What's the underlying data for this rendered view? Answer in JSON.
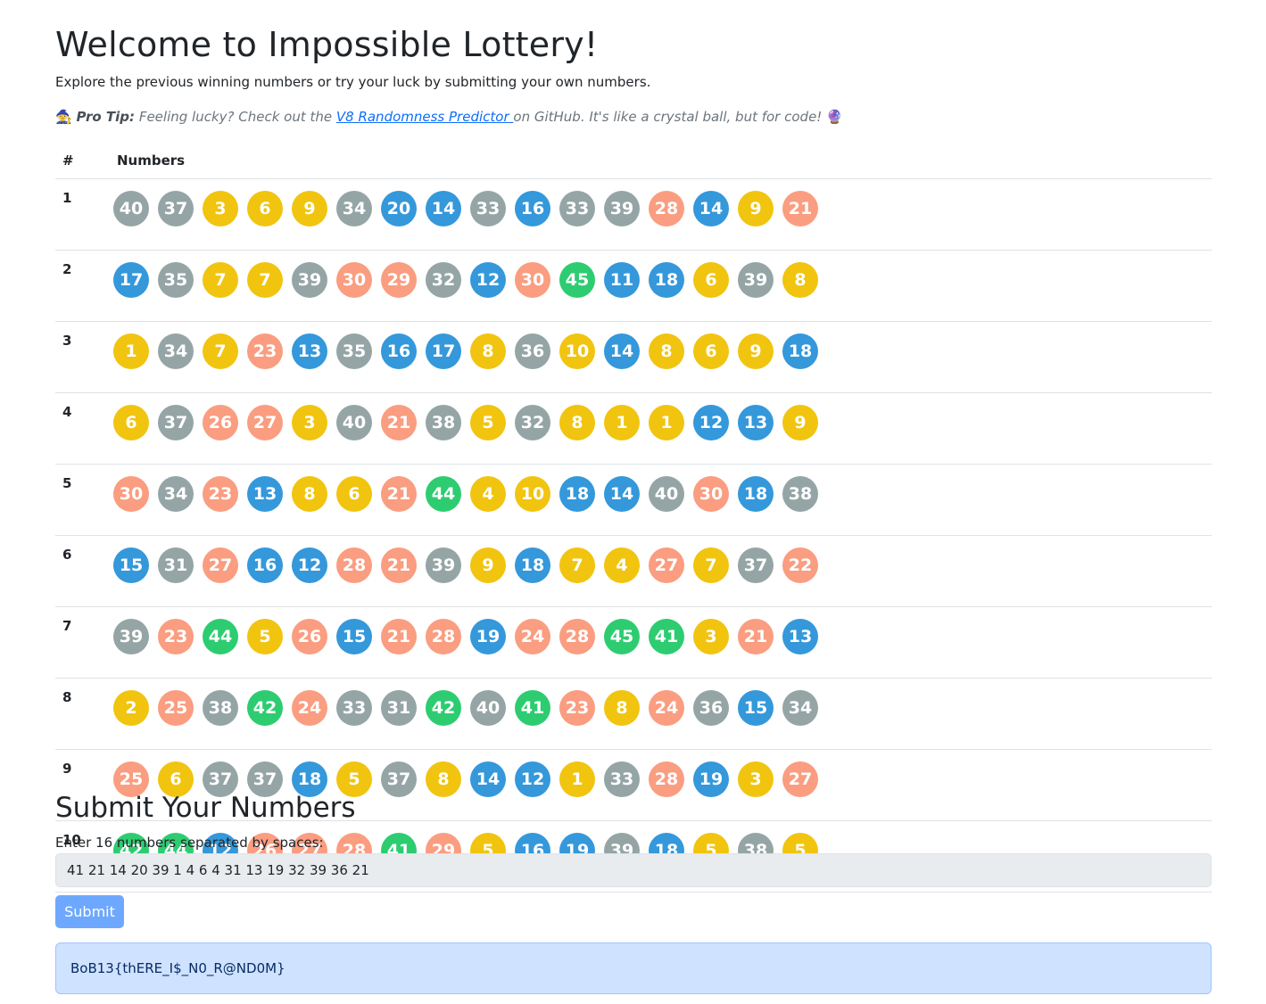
{
  "header": {
    "title": "Welcome to Impossible Lottery!",
    "lead": "Explore the previous winning numbers or try your luck by submitting your own numbers."
  },
  "tip": {
    "icon_start": "🧙",
    "label": "Pro Tip:",
    "before_link": " Feeling lucky? Check out the ",
    "link_text": "V8 Randomness Predictor ",
    "after_link": "on GitHub. It's like a crystal ball, but for code! ",
    "icon_end": "🔮"
  },
  "table": {
    "headers": [
      "#",
      "Numbers"
    ],
    "rows": [
      {
        "index": "1",
        "numbers": [
          40,
          37,
          3,
          6,
          9,
          34,
          20,
          14,
          33,
          16,
          33,
          39,
          28,
          14,
          9,
          21
        ]
      },
      {
        "index": "2",
        "numbers": [
          17,
          35,
          7,
          7,
          39,
          30,
          29,
          32,
          12,
          30,
          45,
          11,
          18,
          6,
          39,
          8
        ]
      },
      {
        "index": "3",
        "numbers": [
          1,
          34,
          7,
          23,
          13,
          35,
          16,
          17,
          8,
          36,
          10,
          14,
          8,
          6,
          9,
          18
        ]
      },
      {
        "index": "4",
        "numbers": [
          6,
          37,
          26,
          27,
          3,
          40,
          21,
          38,
          5,
          32,
          8,
          1,
          1,
          12,
          13,
          9
        ]
      },
      {
        "index": "5",
        "numbers": [
          30,
          34,
          23,
          13,
          8,
          6,
          21,
          44,
          4,
          10,
          18,
          14,
          40,
          30,
          18,
          38
        ]
      },
      {
        "index": "6",
        "numbers": [
          15,
          31,
          27,
          16,
          12,
          28,
          21,
          39,
          9,
          18,
          7,
          4,
          27,
          7,
          37,
          22
        ]
      },
      {
        "index": "7",
        "numbers": [
          39,
          23,
          44,
          5,
          26,
          15,
          21,
          28,
          19,
          24,
          28,
          45,
          41,
          3,
          21,
          13
        ]
      },
      {
        "index": "8",
        "numbers": [
          2,
          25,
          38,
          42,
          24,
          33,
          31,
          42,
          40,
          41,
          23,
          8,
          24,
          36,
          15,
          34
        ]
      },
      {
        "index": "9",
        "numbers": [
          25,
          6,
          37,
          37,
          18,
          5,
          37,
          8,
          14,
          12,
          1,
          33,
          28,
          19,
          3,
          27
        ]
      },
      {
        "index": "10",
        "numbers": [
          42,
          44,
          12,
          26,
          27,
          28,
          41,
          29,
          5,
          16,
          19,
          39,
          18,
          5,
          38,
          5
        ]
      }
    ]
  },
  "ball_colors": {
    "1-10": "#f1c40f",
    "11-20": "#3498db",
    "21-30": "#fa9d80",
    "31-40": "#95a5a6",
    "41-45": "#2ecc71"
  },
  "form": {
    "title": "Submit Your Numbers",
    "label": "Enter 16 numbers separated by spaces:",
    "value": "41 21 14 20 39 1 4 6 4 31 13 19 32 39 36 21",
    "submit_label": "Submit"
  },
  "result": {
    "text": "BoB13{thERE_I$_N0_R@ND0M}"
  }
}
